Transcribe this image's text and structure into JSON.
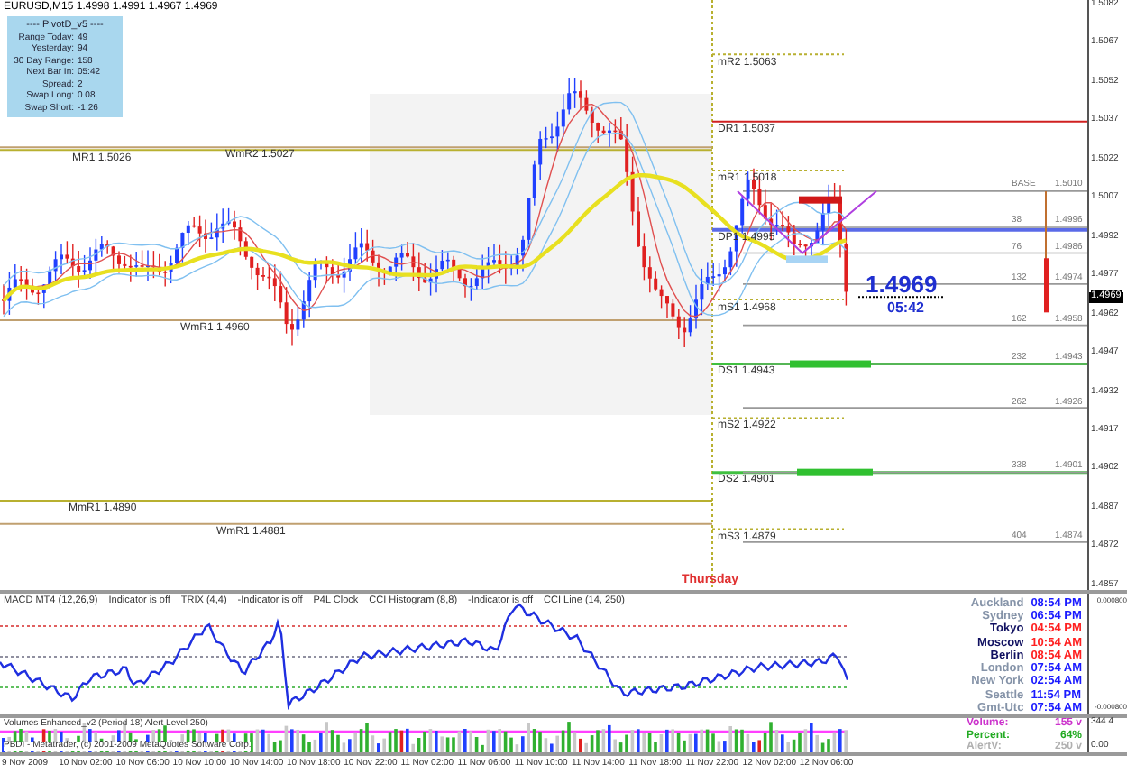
{
  "window": {
    "symbol": "EURUSD,M15",
    "quote": "1.4998 1.4991 1.4967 1.4969"
  },
  "info_panel": {
    "title": "---- PivotD_v5 ----",
    "rows": [
      {
        "label": "Range Today:",
        "value": "49"
      },
      {
        "label": "Yesterday:",
        "value": "94"
      },
      {
        "label": "30 Day Range:",
        "value": "158"
      },
      {
        "label": "Next Bar In:",
        "value": "05:42"
      },
      {
        "label": "Spread:",
        "value": "2"
      },
      {
        "label": "Swap Long:",
        "value": "0.08"
      },
      {
        "label": "Swap Short:",
        "value": "-1.26"
      }
    ]
  },
  "levels": [
    {
      "label": "MR1 1.5026",
      "kind": "monthly"
    },
    {
      "label": "WmR2 1.5027",
      "kind": "weekly"
    },
    {
      "label": "mR2 1.5063",
      "kind": "mid"
    },
    {
      "label": "DR1 1.5037",
      "kind": "daily_resistance"
    },
    {
      "label": "mR1 1.5018",
      "kind": "mid"
    },
    {
      "label": "DP1 1.4995",
      "kind": "daily_pivot"
    },
    {
      "label": "WmR1 1.4960",
      "kind": "weekly"
    },
    {
      "label": "mS1 1.4968",
      "kind": "mid"
    },
    {
      "label": "DS1 1.4943",
      "kind": "daily_support"
    },
    {
      "label": "mS2 1.4922",
      "kind": "mid"
    },
    {
      "label": "DS2 1.4901",
      "kind": "daily_support"
    },
    {
      "label": "MmR1 1.4890",
      "kind": "monthly"
    },
    {
      "label": "WmR1 1.4881",
      "kind": "weekly"
    },
    {
      "label": "mS3 1.4879",
      "kind": "mid"
    }
  ],
  "fib_levels": [
    {
      "ratio": "BASE",
      "price": "1.5010"
    },
    {
      "ratio": "38",
      "price": "1.4996"
    },
    {
      "ratio": "76",
      "price": "1.4986"
    },
    {
      "ratio": "132",
      "price": "1.4974"
    },
    {
      "ratio": "162",
      "price": "1.4958"
    },
    {
      "ratio": "232",
      "price": "1.4943"
    },
    {
      "ratio": "262",
      "price": "1.4926"
    },
    {
      "ratio": "338",
      "price": "1.4901"
    },
    {
      "ratio": "404",
      "price": "1.4874"
    }
  ],
  "current_price": {
    "price": "1.4969",
    "countdown": "05:42"
  },
  "day_label": "Thursday",
  "price_axis": {
    "ticks": [
      "1.5082",
      "1.5067",
      "1.5052",
      "1.5037",
      "1.5022",
      "1.5007",
      "1.4992",
      "1.4977",
      "1.4962",
      "1.4947",
      "1.4932",
      "1.4917",
      "1.4902",
      "1.4887",
      "1.4872",
      "1.4857"
    ],
    "current": "1.4969"
  },
  "macd_panel": {
    "legend": [
      "MACD MT4 (12,26,9)",
      "Indicator is off",
      "TRIX (4,4)",
      "-Indicator is off",
      "P4L Clock",
      "CCI Histogram (8,8)",
      "-Indicator is off",
      "CCI Line (14, 250)"
    ],
    "axis": [
      "0.000800",
      "-0.000800"
    ]
  },
  "clocks": [
    {
      "city": "Auckland",
      "time": "08:54 PM",
      "color": "#1a1aff",
      "active": false
    },
    {
      "city": "Sydney",
      "time": "06:54 PM",
      "color": "#1a1aff",
      "active": false
    },
    {
      "city": "Tokyo",
      "time": "04:54 PM",
      "color": "#ff2020",
      "active": true
    },
    {
      "city": "Moscow",
      "time": "10:54 AM",
      "color": "#ff2020",
      "active": true
    },
    {
      "city": "Berlin",
      "time": "08:54 AM",
      "color": "#ff2020",
      "active": true
    },
    {
      "city": "London",
      "time": "07:54 AM",
      "color": "#1a1aff",
      "active": false
    },
    {
      "city": "New York",
      "time": "02:54 AM",
      "color": "#1a1aff",
      "active": false
    },
    {
      "city": "Seattle",
      "time": "11:54 PM",
      "color": "#1a1aff",
      "active": false
    },
    {
      "city": "Gmt-Utc",
      "time": "07:54 AM",
      "color": "#1a1aff",
      "active": false
    }
  ],
  "volume_panel": {
    "legend": "Volumes Enhanced_v2 (Period 18) Alert Level 250)",
    "copyright": "PBDI - Metatrader, (c) 2001-2009 MetaQuotes Software Corp.",
    "axis": [
      "344.4",
      "0.00"
    ],
    "stats": [
      {
        "label": "Volume:",
        "value": "155 v",
        "color": "#cc33cc"
      },
      {
        "label": "Percent:",
        "value": "64%",
        "color": "#22aa22"
      },
      {
        "label": "AlertV:",
        "value": "250 v",
        "color": "#b0b0b0"
      }
    ]
  },
  "time_axis": [
    "9 Nov 2009",
    "10 Nov 02:00",
    "10 Nov 06:00",
    "10 Nov 10:00",
    "10 Nov 14:00",
    "10 Nov 18:00",
    "10 Nov 22:00",
    "11 Nov 02:00",
    "11 Nov 06:00",
    "11 Nov 10:00",
    "11 Nov 14:00",
    "11 Nov 18:00",
    "11 Nov 22:00",
    "12 Nov 02:00",
    "12 Nov 06:00"
  ]
}
